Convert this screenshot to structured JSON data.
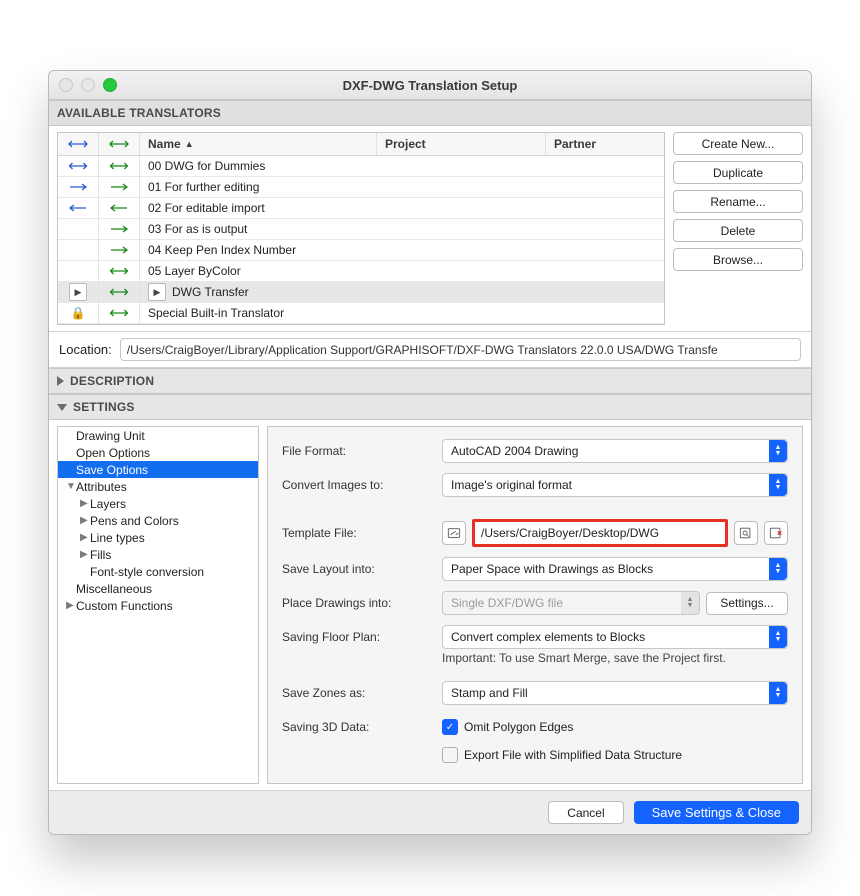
{
  "window": {
    "title": "DXF-DWG Translation Setup"
  },
  "sections": {
    "available": "AVAILABLE TRANSLATORS",
    "description": "DESCRIPTION",
    "settings": "SETTINGS"
  },
  "table": {
    "headers": {
      "name": "Name",
      "project": "Project",
      "partner": "Partner"
    },
    "rows": [
      {
        "name": "00 DWG for Dummies",
        "in": "blue-bi",
        "out": "green-bi"
      },
      {
        "name": "01 For further editing",
        "in": "blue-right",
        "out": "green-right"
      },
      {
        "name": "02 For editable import",
        "in": "blue-left",
        "out": "green-left"
      },
      {
        "name": "03 For as is output",
        "in": "none",
        "out": "green-right"
      },
      {
        "name": "04 Keep Pen Index Number",
        "in": "none",
        "out": "green-right"
      },
      {
        "name": "05 Layer ByColor",
        "in": "none",
        "out": "green-bi"
      },
      {
        "name": "DWG Transfer",
        "in": "chevron",
        "out": "green-bi",
        "selected": true,
        "hasChevrons": true
      },
      {
        "name": "Special Built-in Translator",
        "in": "lock",
        "out": "green-bi"
      }
    ]
  },
  "sideButtons": {
    "create": "Create New...",
    "duplicate": "Duplicate",
    "rename": "Rename...",
    "delete": "Delete",
    "browse": "Browse..."
  },
  "location": {
    "label": "Location:",
    "value": "/Users/CraigBoyer/Library/Application Support/GRAPHISOFT/DXF-DWG Translators 22.0.0 USA/DWG Transfe"
  },
  "tree": {
    "items": [
      {
        "label": "Drawing Unit",
        "level": 0
      },
      {
        "label": "Open Options",
        "level": 0
      },
      {
        "label": "Save Options",
        "level": 0,
        "selected": true
      },
      {
        "label": "Attributes",
        "level": 0,
        "arrow": "down"
      },
      {
        "label": "Layers",
        "level": 1,
        "arrow": "right"
      },
      {
        "label": "Pens and Colors",
        "level": 1,
        "arrow": "right"
      },
      {
        "label": "Line types",
        "level": 1,
        "arrow": "right"
      },
      {
        "label": "Fills",
        "level": 1,
        "arrow": "right"
      },
      {
        "label": "Font-style conversion",
        "level": 1
      },
      {
        "label": "Miscellaneous",
        "level": 0
      },
      {
        "label": "Custom Functions",
        "level": 0,
        "arrow": "right"
      }
    ]
  },
  "form": {
    "fileFormat": {
      "label": "File Format:",
      "value": "AutoCAD 2004 Drawing"
    },
    "convertImages": {
      "label": "Convert Images to:",
      "value": "Image's original format"
    },
    "templateFile": {
      "label": "Template File:",
      "value": "/Users/CraigBoyer/Desktop/DWG"
    },
    "saveLayout": {
      "label": "Save Layout into:",
      "value": "Paper Space with Drawings as Blocks"
    },
    "placeDrawings": {
      "label": "Place Drawings into:",
      "value": "Single DXF/DWG file",
      "settings": "Settings..."
    },
    "savingFloorPlan": {
      "label": "Saving Floor Plan:",
      "value": "Convert complex elements to Blocks"
    },
    "note": "Important: To use Smart Merge, save the Project first.",
    "saveZones": {
      "label": "Save Zones as:",
      "value": "Stamp and Fill"
    },
    "saving3D": {
      "label": "Saving 3D Data:"
    },
    "omitPolygon": "Omit Polygon Edges",
    "exportFile": "Export File with Simplified Data Structure"
  },
  "footer": {
    "cancel": "Cancel",
    "save": "Save Settings & Close"
  }
}
